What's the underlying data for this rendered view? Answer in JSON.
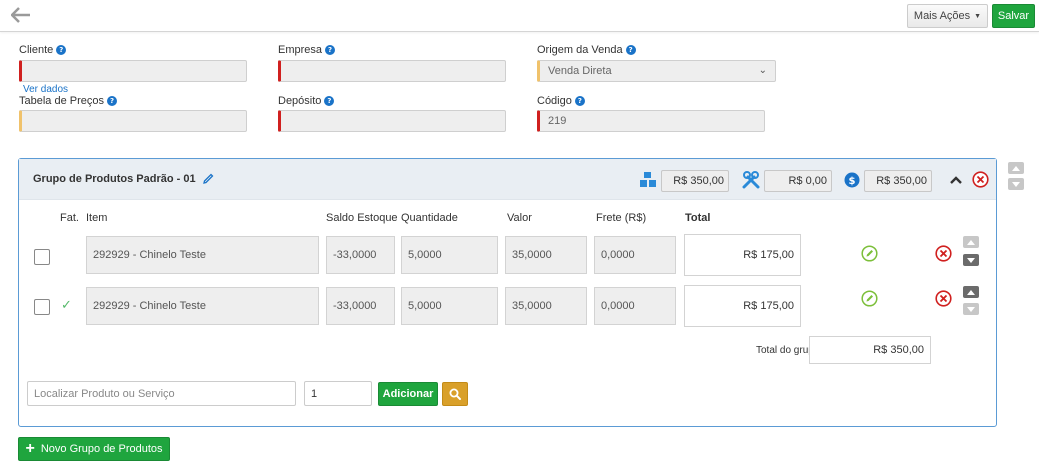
{
  "toolbar": {
    "mais_acoes_label": "Mais Ações",
    "salvar_label": "Salvar"
  },
  "form": {
    "cliente": {
      "label": "Cliente",
      "value": ""
    },
    "ver_dados": "Ver dados",
    "empresa": {
      "label": "Empresa",
      "value": ""
    },
    "origem_venda": {
      "label": "Origem da Venda",
      "value": "Venda Direta"
    },
    "tabela_precos": {
      "label": "Tabela de Preços",
      "value": ""
    },
    "deposito": {
      "label": "Depósito",
      "value": ""
    },
    "codigo": {
      "label": "Código",
      "value": "219"
    }
  },
  "group": {
    "title": "Grupo de Produtos Padrão - 01",
    "total_products": "R$ 350,00",
    "total_services": "R$ 0,00",
    "total_value": "R$ 350,00",
    "columns": {
      "fat": "Fat.",
      "item": "Item",
      "saldo": "Saldo Estoque",
      "quantidade": "Quantidade",
      "valor": "Valor",
      "frete": "Frete (R$)",
      "total": "Total"
    },
    "rows": [
      {
        "fat": false,
        "item": "292929 - Chinelo Teste",
        "saldo": "-33,0000",
        "quantidade": "5,0000",
        "valor": "35,0000",
        "frete": "0,0000",
        "total": "R$ 175,00"
      },
      {
        "fat": true,
        "item": "292929 - Chinelo Teste",
        "saldo": "-33,0000",
        "quantidade": "5,0000",
        "valor": "35,0000",
        "frete": "0,0000",
        "total": "R$ 175,00"
      }
    ],
    "total_do_grupo_label": "Total do grupo",
    "total_do_grupo_value": "R$ 350,00",
    "search_placeholder": "Localizar Produto ou Serviço",
    "quantity_value": "1",
    "adicionar_label": "Adicionar"
  },
  "novo_grupo_label": "Novo Grupo de Produtos",
  "colors": {
    "green": "#1fa53e",
    "blue": "#1a73c8",
    "red": "#d0201f",
    "orange": "#d9a02a"
  }
}
